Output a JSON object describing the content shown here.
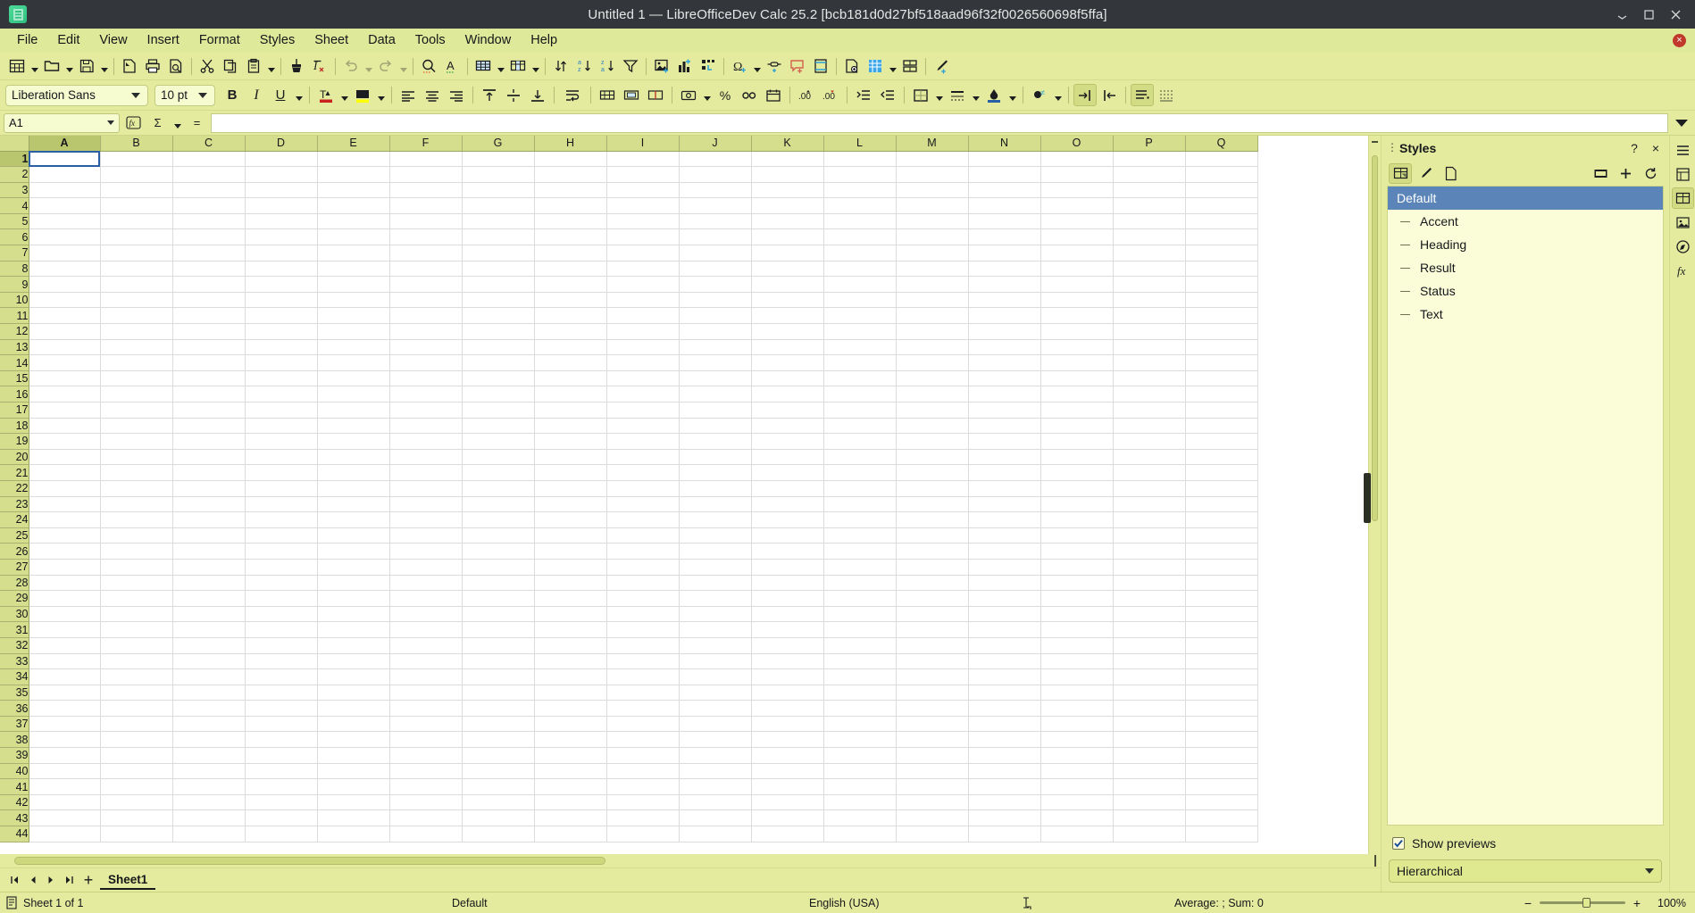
{
  "titlebar": {
    "title": "Untitled 1 — LibreOfficeDev Calc 25.2 [bcb181d0d27bf518aad96f32f0026560698f5ffa]",
    "app_icon": "calc-document-icon",
    "minimize": "minimize-icon",
    "maximize": "maximize-icon",
    "close": "close-icon"
  },
  "menubar": {
    "items": [
      {
        "label": "File"
      },
      {
        "label": "Edit"
      },
      {
        "label": "View"
      },
      {
        "label": "Insert"
      },
      {
        "label": "Format"
      },
      {
        "label": "Styles"
      },
      {
        "label": "Sheet"
      },
      {
        "label": "Data"
      },
      {
        "label": "Tools"
      },
      {
        "label": "Window"
      },
      {
        "label": "Help"
      }
    ],
    "close_document": "×"
  },
  "standard_toolbar": {
    "items": [
      {
        "name": "new-document",
        "icon": "new-spreadsheet-icon",
        "dropdown": true,
        "disabled": false
      },
      {
        "name": "open",
        "icon": "open-folder-icon",
        "dropdown": true,
        "disabled": false
      },
      {
        "name": "save",
        "icon": "save-floppy-icon",
        "dropdown": true,
        "disabled": false
      },
      {
        "name": "export-pdf",
        "icon": "pdf-export-icon",
        "dropdown": false,
        "disabled": false
      },
      {
        "name": "print",
        "icon": "printer-icon",
        "dropdown": false,
        "disabled": false
      },
      {
        "name": "print-preview",
        "icon": "print-preview-icon",
        "dropdown": false,
        "disabled": false
      },
      {
        "name": "cut",
        "icon": "scissors-icon",
        "dropdown": false,
        "disabled": false
      },
      {
        "name": "copy",
        "icon": "copy-icon",
        "dropdown": false,
        "disabled": false
      },
      {
        "name": "paste",
        "icon": "clipboard-icon",
        "dropdown": true,
        "disabled": false
      },
      {
        "name": "clone-formatting",
        "icon": "paintbrush-icon",
        "dropdown": false,
        "disabled": false
      },
      {
        "name": "clear-formatting",
        "icon": "clear-formatting-icon",
        "dropdown": false,
        "disabled": false
      },
      {
        "name": "undo",
        "icon": "undo-arrow-icon",
        "dropdown": true,
        "disabled": true
      },
      {
        "name": "redo",
        "icon": "redo-arrow-icon",
        "dropdown": true,
        "disabled": true
      },
      {
        "name": "find-and-replace",
        "icon": "magnifier-icon",
        "dropdown": false,
        "disabled": false
      },
      {
        "name": "spelling",
        "icon": "spelling-abc-icon",
        "dropdown": false,
        "disabled": false
      },
      {
        "name": "row",
        "icon": "insert-row-icon",
        "dropdown": true,
        "disabled": false
      },
      {
        "name": "column",
        "icon": "insert-column-icon",
        "dropdown": true,
        "disabled": false
      },
      {
        "name": "sort",
        "icon": "sort-icon",
        "dropdown": false,
        "disabled": false
      },
      {
        "name": "sort-ascending",
        "icon": "sort-ascending-icon",
        "dropdown": false,
        "disabled": false
      },
      {
        "name": "sort-descending",
        "icon": "sort-descending-icon",
        "dropdown": false,
        "disabled": false
      },
      {
        "name": "autofilter",
        "icon": "funnel-filter-icon",
        "dropdown": false,
        "disabled": false
      },
      {
        "name": "insert-image",
        "icon": "image-icon",
        "dropdown": false,
        "disabled": false
      },
      {
        "name": "insert-chart",
        "icon": "bar-chart-icon",
        "dropdown": false,
        "disabled": false
      },
      {
        "name": "pivot-table",
        "icon": "pivot-table-icon",
        "dropdown": false,
        "disabled": false
      },
      {
        "name": "special-character",
        "icon": "omega-icon",
        "dropdown": true,
        "disabled": false
      },
      {
        "name": "insert-hyperlink",
        "icon": "hyperlink-icon",
        "dropdown": false,
        "disabled": false
      },
      {
        "name": "insert-comment",
        "icon": "comment-icon",
        "dropdown": false,
        "disabled": false
      },
      {
        "name": "headers-and-footers",
        "icon": "header-footer-icon",
        "dropdown": false,
        "disabled": false
      },
      {
        "name": "define-print-area",
        "icon": "print-area-icon",
        "dropdown": false,
        "disabled": false
      },
      {
        "name": "freeze-rows-columns",
        "icon": "freeze-panes-icon",
        "dropdown": true,
        "disabled": false
      },
      {
        "name": "split-window",
        "icon": "split-window-icon",
        "dropdown": false,
        "disabled": false
      },
      {
        "name": "show-draw-functions",
        "icon": "draw-functions-icon",
        "dropdown": false,
        "disabled": false
      }
    ]
  },
  "formatting_toolbar": {
    "font_name": "Liberation Sans",
    "font_size": "10 pt",
    "items": [
      {
        "name": "bold",
        "icon": "bold-icon",
        "glyph": "B"
      },
      {
        "name": "italic",
        "icon": "italic-icon",
        "glyph": "I"
      },
      {
        "name": "underline",
        "icon": "underline-icon",
        "glyph": "U",
        "dropdown": true
      },
      {
        "name": "font-color",
        "icon": "font-color-icon",
        "dropdown": true,
        "color": "#c9211e"
      },
      {
        "name": "background-color",
        "icon": "highlight-color-icon",
        "dropdown": true,
        "color": "#ffff00"
      },
      {
        "name": "align-left",
        "icon": "align-left-icon"
      },
      {
        "name": "align-center",
        "icon": "align-center-icon"
      },
      {
        "name": "align-right",
        "icon": "align-right-icon"
      },
      {
        "name": "align-top",
        "icon": "align-top-icon"
      },
      {
        "name": "center-vertically",
        "icon": "align-middle-icon"
      },
      {
        "name": "align-bottom",
        "icon": "align-bottom-icon"
      },
      {
        "name": "wrap-text",
        "icon": "wrap-text-icon"
      },
      {
        "name": "merge-cells",
        "icon": "merge-cells-icon"
      },
      {
        "name": "merge-and-center",
        "icon": "merge-center-icon"
      },
      {
        "name": "unmerge-cells",
        "icon": "unmerge-cells-icon"
      },
      {
        "name": "format-as-currency",
        "icon": "currency-icon",
        "dropdown": true
      },
      {
        "name": "format-as-percent",
        "icon": "percent-icon",
        "glyph": "%"
      },
      {
        "name": "format-as-number",
        "icon": "number-format-icon"
      },
      {
        "name": "format-as-date",
        "icon": "date-format-icon"
      },
      {
        "name": "add-decimal-place",
        "icon": "add-decimal-icon"
      },
      {
        "name": "delete-decimal-place",
        "icon": "delete-decimal-icon"
      },
      {
        "name": "increase-indent",
        "icon": "increase-indent-icon"
      },
      {
        "name": "decrease-indent",
        "icon": "decrease-indent-icon"
      },
      {
        "name": "borders",
        "icon": "borders-icon",
        "dropdown": true
      },
      {
        "name": "border-style",
        "icon": "border-style-icon",
        "dropdown": true
      },
      {
        "name": "border-color",
        "icon": "border-color-icon",
        "dropdown": true
      },
      {
        "name": "conditional-formatting",
        "icon": "conditional-format-icon",
        "dropdown": true
      },
      {
        "name": "insert-column-right",
        "icon": "insert-column-right-icon"
      },
      {
        "name": "insert-row-above",
        "icon": "insert-row-above-icon"
      },
      {
        "name": "sidebar-settings",
        "icon": "sidebar-settings-icon"
      },
      {
        "name": "toggle-grid-lines",
        "icon": "grid-lines-icon"
      }
    ]
  },
  "formula_bar": {
    "name_box_value": "A1",
    "function_wizard": "fx",
    "select_function": "Σ",
    "formula": "=",
    "input_value": "",
    "expand_formula_bar": "expand-icon"
  },
  "grid": {
    "columns": [
      "A",
      "B",
      "C",
      "D",
      "E",
      "F",
      "G",
      "H",
      "I",
      "J",
      "K",
      "L",
      "M",
      "N",
      "O",
      "P",
      "Q"
    ],
    "rows": [
      1,
      2,
      3,
      4,
      5,
      6,
      7,
      8,
      9,
      10,
      11,
      12,
      13,
      14,
      15,
      16,
      17,
      18,
      19,
      20,
      21,
      22,
      23,
      24,
      25,
      26,
      27,
      28,
      29,
      30,
      31,
      32,
      33,
      34,
      35,
      36,
      37,
      38,
      39,
      40,
      41,
      42,
      43,
      44
    ],
    "active_cell": {
      "column": "A",
      "row": 1
    }
  },
  "sheet_tabs": {
    "first": "first-sheet-icon",
    "previous": "previous-sheet-icon",
    "next": "next-sheet-icon",
    "last": "last-sheet-icon",
    "add": "+",
    "tabs": [
      {
        "label": "Sheet1",
        "active": true
      }
    ]
  },
  "sidebar": {
    "title": "Styles",
    "help_button": "?",
    "close_button": "×",
    "sidebar_settings": "sidebar-menu-icon",
    "toolbar": [
      {
        "name": "cell-styles",
        "icon": "cell-styles-icon",
        "active": true
      },
      {
        "name": "page-styles",
        "icon": "page-styles-icon",
        "active": false
      },
      {
        "name": "new-style-from-selection",
        "icon": "new-style-icon",
        "active": false
      }
    ],
    "actions": [
      {
        "name": "style-preview-toggle",
        "icon": "preview-toggle-icon"
      },
      {
        "name": "new-style",
        "icon": "plus-icon"
      },
      {
        "name": "update-style",
        "icon": "refresh-icon"
      }
    ],
    "styles": [
      {
        "label": "Default",
        "selected": true,
        "child": false
      },
      {
        "label": "Accent",
        "selected": false,
        "child": true
      },
      {
        "label": "Heading",
        "selected": false,
        "child": true
      },
      {
        "label": "Result",
        "selected": false,
        "child": true
      },
      {
        "label": "Status",
        "selected": false,
        "child": true
      },
      {
        "label": "Text",
        "selected": false,
        "child": true
      }
    ],
    "show_previews_label": "Show previews",
    "show_previews_checked": true,
    "filter_value": "Hierarchical",
    "rail": [
      {
        "name": "sidebar-settings",
        "icon": "hamburger-icon",
        "active": false
      },
      {
        "name": "properties",
        "icon": "properties-icon",
        "active": false
      },
      {
        "name": "styles",
        "icon": "styles-panel-icon",
        "active": true
      },
      {
        "name": "gallery",
        "icon": "gallery-icon",
        "active": false
      },
      {
        "name": "navigator",
        "icon": "navigator-compass-icon",
        "active": false
      },
      {
        "name": "functions",
        "icon": "functions-fx-icon",
        "active": false
      }
    ]
  },
  "statusbar": {
    "save_icon": "document-modified-icon",
    "sheet_info": "Sheet 1 of 1",
    "page_style": "Default",
    "language": "English (USA)",
    "selection_mode_icon": "selection-mode-icon",
    "average_sum": "Average: ; Sum: 0",
    "zoom_minus": "−",
    "zoom_plus": "+",
    "zoom_value": "100%"
  }
}
